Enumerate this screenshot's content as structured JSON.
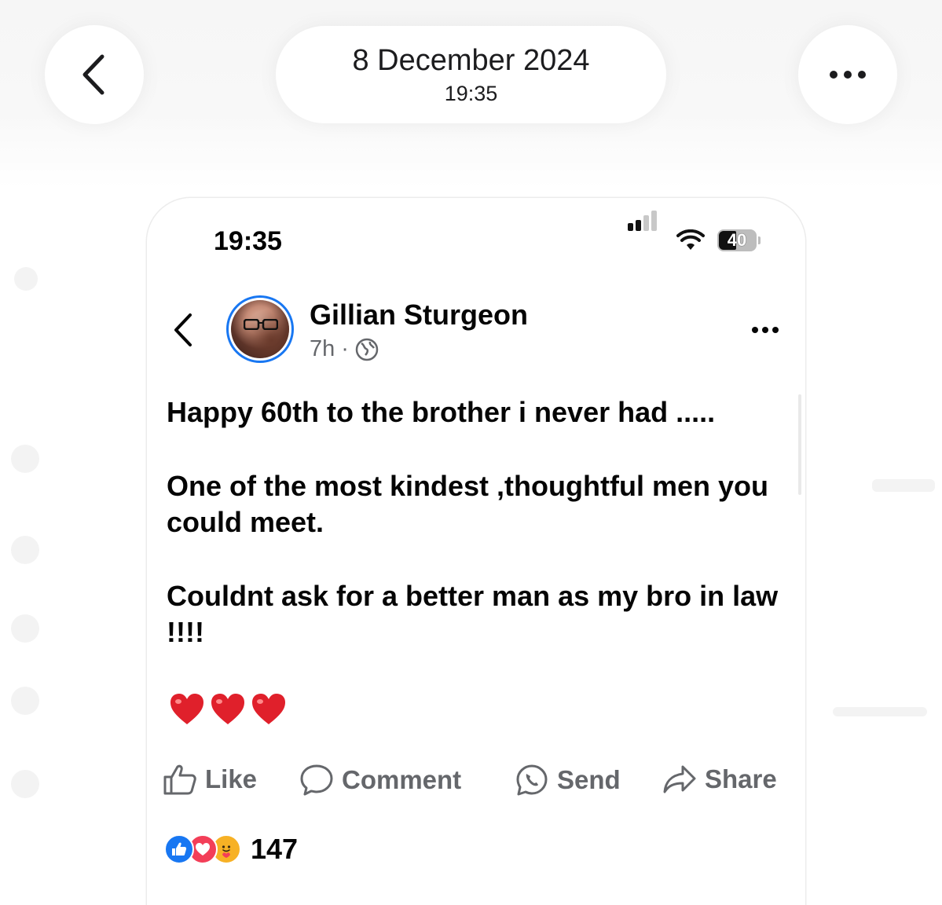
{
  "viewer": {
    "date": "8 December 2024",
    "time": "19:35",
    "back_icon": "chevron-left-icon",
    "more_icon": "ellipsis-icon"
  },
  "status_bar": {
    "time": "19:35",
    "battery_level": "40",
    "signal_bars": 2,
    "wifi": true
  },
  "post": {
    "author": "Gillian Sturgeon",
    "age": "7h",
    "separator": "·",
    "privacy_icon": "globe-icon",
    "paragraphs": [
      "Happy 60th to the brother i never had .....",
      "One of the most kindest ,thoughtful men you could meet.",
      "Couldnt ask for a better man as my bro in law !!!!"
    ],
    "emoji": [
      "heart-emoji",
      "heart-emoji",
      "heart-emoji"
    ]
  },
  "actions": {
    "like": "Like",
    "comment": "Comment",
    "send": "Send",
    "share": "Share"
  },
  "reactions": {
    "types": [
      "like",
      "love",
      "care"
    ],
    "count": "147"
  },
  "colors": {
    "fb_blue": "#1877f2",
    "love_red": "#f33e58",
    "care_yellow": "#f7b125",
    "muted_text": "#65676b"
  }
}
